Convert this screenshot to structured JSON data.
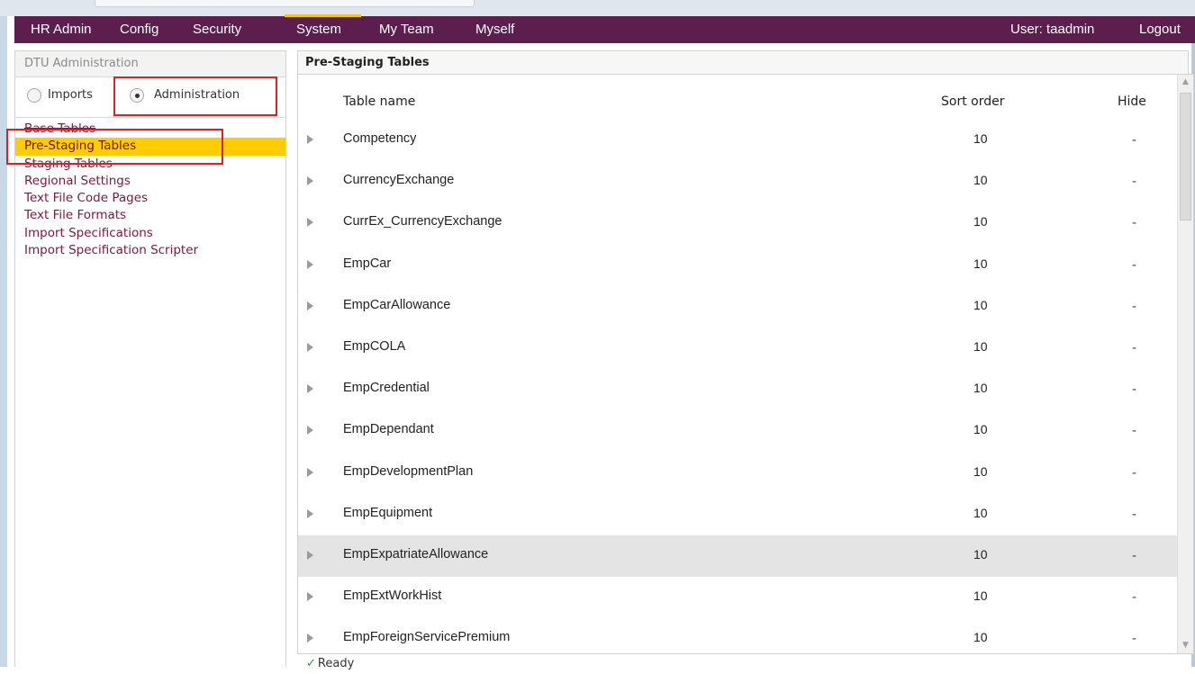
{
  "navbar": {
    "items": [
      {
        "label": "HR Admin"
      },
      {
        "label": "Config"
      },
      {
        "label": "Security"
      },
      {
        "label": "System"
      },
      {
        "label": "My Team"
      },
      {
        "label": "Myself"
      }
    ],
    "active": "System",
    "user": "User: taadmin",
    "logout": "Logout",
    "accent_color": "#5c1f4d",
    "active_indicator_color": "#f5c518"
  },
  "sidebar": {
    "title": "DTU Administration",
    "radios": [
      {
        "label": "Imports",
        "checked": false
      },
      {
        "label": "Administration",
        "checked": true
      }
    ],
    "links": [
      {
        "label": "Base Tables"
      },
      {
        "label": "Pre-Staging Tables"
      },
      {
        "label": "Staging Tables"
      },
      {
        "label": "Regional Settings"
      },
      {
        "label": "Text File Code Pages"
      },
      {
        "label": "Text File Formats"
      },
      {
        "label": "Import Specifications"
      },
      {
        "label": "Import Specification Scripter"
      }
    ],
    "selected": "Pre-Staging Tables",
    "highlight_color": "#ffcc00"
  },
  "main": {
    "title": "Pre-Staging Tables",
    "columns": {
      "name": "Table name",
      "sort": "Sort order",
      "hide": "Hide"
    },
    "rows": [
      {
        "name": "Competency",
        "sort": "10",
        "hide": "-"
      },
      {
        "name": "CurrencyExchange",
        "sort": "10",
        "hide": "-"
      },
      {
        "name": "CurrEx_CurrencyExchange",
        "sort": "10",
        "hide": "-"
      },
      {
        "name": "EmpCar",
        "sort": "10",
        "hide": "-"
      },
      {
        "name": "EmpCarAllowance",
        "sort": "10",
        "hide": "-"
      },
      {
        "name": "EmpCOLA",
        "sort": "10",
        "hide": "-"
      },
      {
        "name": "EmpCredential",
        "sort": "10",
        "hide": "-"
      },
      {
        "name": "EmpDependant",
        "sort": "10",
        "hide": "-"
      },
      {
        "name": "EmpDevelopmentPlan",
        "sort": "10",
        "hide": "-"
      },
      {
        "name": "EmpEquipment",
        "sort": "10",
        "hide": "-"
      },
      {
        "name": "EmpExpatriateAllowance",
        "sort": "10",
        "hide": "-"
      },
      {
        "name": "EmpExtWorkHist",
        "sort": "10",
        "hide": "-"
      },
      {
        "name": "EmpForeignServicePremium",
        "sort": "10",
        "hide": "-"
      }
    ],
    "hovered_row": "EmpExpatriateAllowance"
  },
  "status": {
    "text": "Ready",
    "icon": "check-icon"
  }
}
